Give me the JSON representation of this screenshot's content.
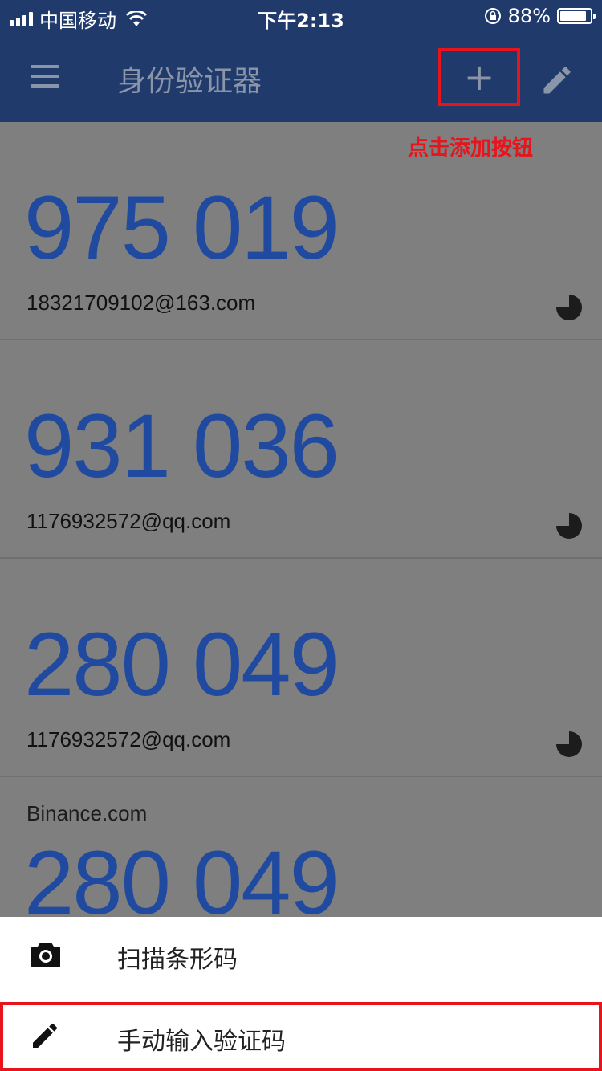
{
  "status_bar": {
    "carrier": "中国移动",
    "time": "下午2:13",
    "battery_percent_label": "88%",
    "battery_level": 0.88
  },
  "app_bar": {
    "title": "身份验证器",
    "add_icon": "plus-icon",
    "edit_icon": "pencil-icon",
    "menu_icon": "hamburger-menu-icon"
  },
  "hint": "点击添加按钮",
  "codes": [
    {
      "issuer": "",
      "code": "975 019",
      "account": "18321709102@163.com"
    },
    {
      "issuer": "",
      "code": "931 036",
      "account": "1176932572@qq.com"
    },
    {
      "issuer": "",
      "code": "280 049",
      "account": "1176932572@qq.com"
    },
    {
      "issuer": "Binance.com",
      "code": "280 049",
      "account": ""
    }
  ],
  "sheet": {
    "scan_label": "扫描条形码",
    "manual_label": "手动输入验证码",
    "scan_icon": "camera-icon",
    "manual_icon": "pencil-icon"
  },
  "colors": {
    "app_bar": "#1f3a6b",
    "code": "#1f4aa0",
    "highlight": "#e8141b",
    "overlay": "#7f7f7f"
  }
}
